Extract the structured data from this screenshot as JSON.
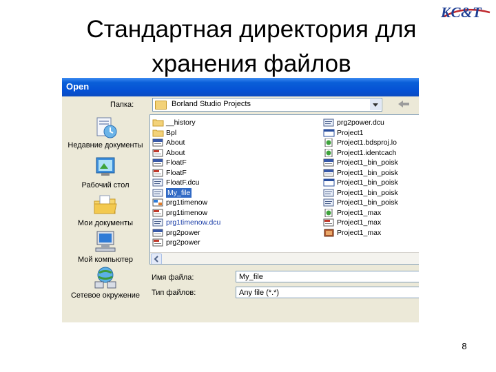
{
  "slide": {
    "title_line1": "Стандартная директория для",
    "title_line2": "хранения файлов",
    "logo": "KC&T",
    "page_number": "8"
  },
  "dialog": {
    "title": "Open",
    "look_in_label": "Папка:",
    "look_in_value": "Borland Studio Projects",
    "places": [
      {
        "label": "Недавние документы",
        "icon": "recent-documents-icon"
      },
      {
        "label": "Рабочий стол",
        "icon": "desktop-icon"
      },
      {
        "label": "Мои документы",
        "icon": "my-documents-icon"
      },
      {
        "label": "Мой компьютер",
        "icon": "my-computer-icon"
      },
      {
        "label": "Сетевое окружение",
        "icon": "network-places-icon"
      }
    ],
    "files_left": [
      {
        "name": "__history",
        "icon": "folder-icon"
      },
      {
        "name": "Bpl",
        "icon": "folder-icon"
      },
      {
        "name": "About",
        "icon": "delphi-unit-icon"
      },
      {
        "name": "About",
        "icon": "pascal-file-icon"
      },
      {
        "name": "FloatF",
        "icon": "delphi-unit-icon"
      },
      {
        "name": "FloatF",
        "icon": "pascal-file-icon"
      },
      {
        "name": "FloatF.dcu",
        "icon": "dcu-file-icon"
      },
      {
        "name": "My_file",
        "icon": "dcu-file-icon",
        "selected": true
      },
      {
        "name": "prg1timenow",
        "icon": "project-group-icon"
      },
      {
        "name": "prg1timenow",
        "icon": "pascal-file-icon"
      },
      {
        "name": "prg1timenow.dcu",
        "icon": "dcu-file-icon",
        "blue": true
      },
      {
        "name": "prg2power",
        "icon": "delphi-unit-icon"
      },
      {
        "name": "prg2power",
        "icon": "pascal-file-icon"
      }
    ],
    "files_right": [
      {
        "name": "prg2power.dcu",
        "icon": "dcu-file-icon"
      },
      {
        "name": "Project1",
        "icon": "window-icon"
      },
      {
        "name": "Project1.bdsproj.lo",
        "icon": "green-doc-icon"
      },
      {
        "name": "Project1.identcach",
        "icon": "green-doc-icon"
      },
      {
        "name": "Project1_bin_poisk",
        "icon": "delphi-unit-icon"
      },
      {
        "name": "Project1_bin_poisk",
        "icon": "delphi-unit-icon"
      },
      {
        "name": "Project1_bin_poisk",
        "icon": "window-icon"
      },
      {
        "name": "Project1_bin_poisk",
        "icon": "dcu-file-icon"
      },
      {
        "name": "Project1_bin_poisk",
        "icon": "dcu-file-icon"
      },
      {
        "name": "Project1_max",
        "icon": "green-doc-icon"
      },
      {
        "name": "Project1_max",
        "icon": "pascal-file-icon"
      },
      {
        "name": "Project1_max",
        "icon": "resource-icon"
      }
    ],
    "filename_label": "Имя файла:",
    "filename_value": "My_file",
    "filetype_label": "Тип файлов:",
    "filetype_value": "Any file (*.*)"
  }
}
